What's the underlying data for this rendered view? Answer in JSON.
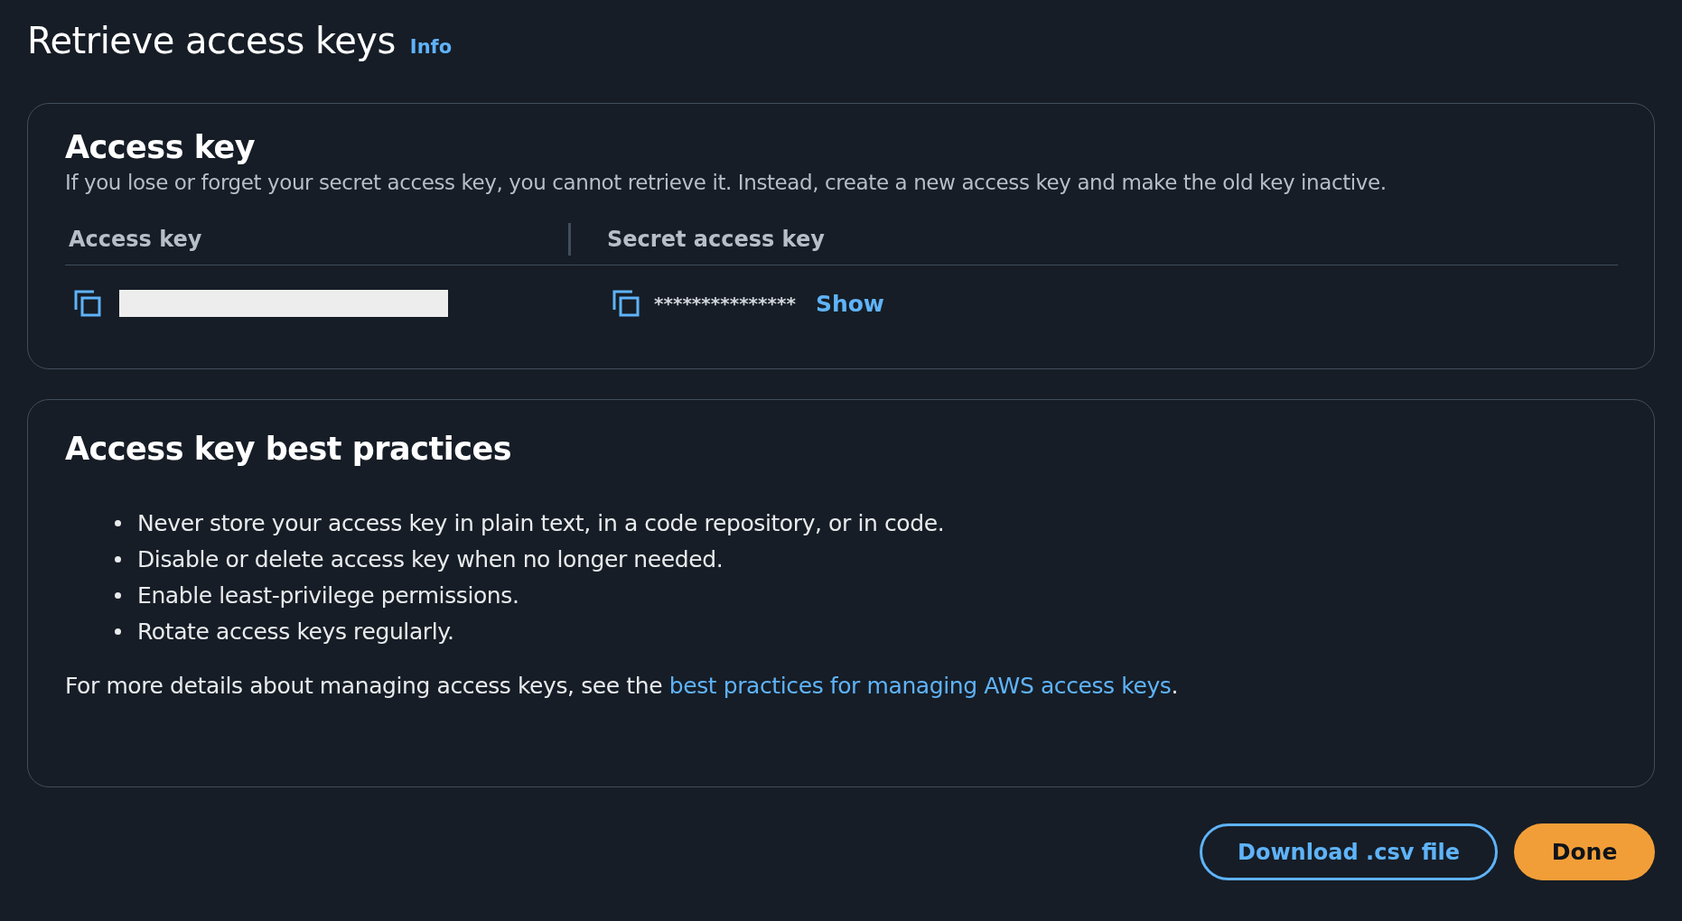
{
  "page": {
    "title": "Retrieve access keys",
    "info_link": "Info"
  },
  "access_key_card": {
    "heading": "Access key",
    "description": "If you lose or forget your secret access key, you cannot retrieve it. Instead, create a new access key and make the old key inactive.",
    "columns": [
      "Access key",
      "Secret access key"
    ],
    "secret_value": "***************",
    "show_link": "Show"
  },
  "best_practices_card": {
    "heading": "Access key best practices",
    "items": [
      "Never store your access key in plain text, in a code repository, or in code.",
      "Disable or delete access key when no longer needed.",
      "Enable least-privilege permissions.",
      "Rotate access keys regularly."
    ],
    "footer": {
      "text_before": "For more details about managing access keys, see the",
      "link": "best practices for managing AWS access keys",
      "text_after": "."
    }
  },
  "buttons": [
    {
      "label": "Download .csv file",
      "kind": "secondary"
    },
    {
      "label": "Done",
      "kind": "primary"
    }
  ]
}
